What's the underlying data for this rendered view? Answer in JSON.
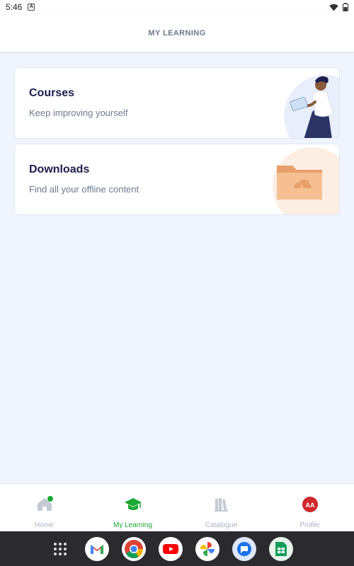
{
  "status_bar": {
    "time": "5:46",
    "notification_letter": "A"
  },
  "header": {
    "title": "MY LEARNING"
  },
  "cards": [
    {
      "title": "Courses",
      "subtitle": "Keep improving yourself",
      "icon": "reader-illustration-icon"
    },
    {
      "title": "Downloads",
      "subtitle": "Find all your offline content",
      "icon": "folder-download-icon"
    }
  ],
  "bottom_nav": {
    "items": [
      {
        "label": "Home",
        "icon": "home-icon",
        "active": false
      },
      {
        "label": "My Learning",
        "icon": "graduation-cap-icon",
        "active": true
      },
      {
        "label": "Catalogue",
        "icon": "books-icon",
        "active": false
      },
      {
        "label": "Profile",
        "icon": "avatar-icon",
        "active": false,
        "avatar_initials": "AA"
      }
    ]
  },
  "dock": {
    "apps": [
      "app-drawer-icon",
      "gmail-icon",
      "chrome-icon",
      "youtube-icon",
      "photos-icon",
      "messages-icon",
      "sheets-icon"
    ]
  },
  "colors": {
    "accent_green": "#1aa832",
    "title_navy": "#1d1f4d",
    "subtitle_gray": "#6c7a8e",
    "background": "#eff4fd",
    "avatar_red": "#d0262c",
    "folder_orange": "#f2b17f"
  }
}
